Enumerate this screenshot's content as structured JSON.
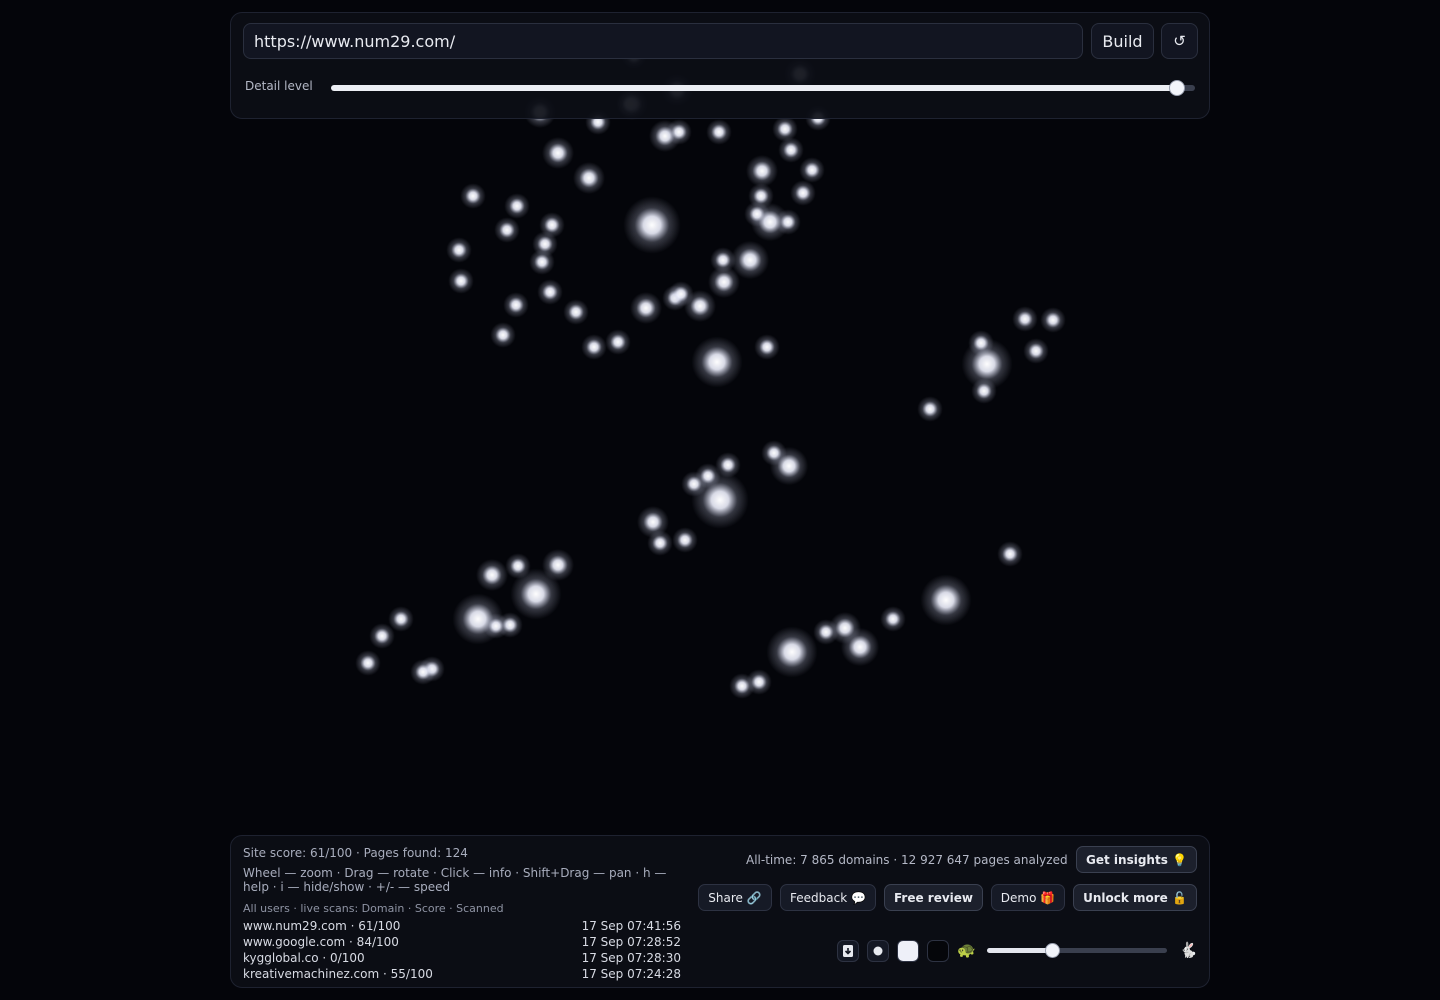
{
  "toolbar": {
    "url_value": "https://www.num29.com/",
    "build_label": "Build",
    "reset_label": "↺",
    "detail_label": "Detail level",
    "detail_value_fraction": 0.98
  },
  "stats": {
    "site_score": "Site score: 61/100 · Pages found: 124",
    "help": "Wheel — zoom · Drag — rotate · Click — info · Shift+Drag — pan · h — help · i — hide/show · +/- — speed",
    "all_time": "All-time: 7 865 domains · 12 927 647 pages analyzed"
  },
  "scans": {
    "header": "All users · live scans: Domain · Score · Scanned",
    "rows": [
      {
        "domain": "www.num29.com · 61/100",
        "time": "17 Sep 07:41:56"
      },
      {
        "domain": "www.google.com · 84/100",
        "time": "17 Sep 07:28:52"
      },
      {
        "domain": "kygglobal.co · 0/100",
        "time": "17 Sep 07:28:30"
      },
      {
        "domain": "kreativemachinez.com · 55/100",
        "time": "17 Sep 07:24:28"
      }
    ]
  },
  "actions": {
    "get_insights": "Get insights 💡",
    "share": "Share 🔗",
    "feedback": "Feedback 💬",
    "free_review": "Free review",
    "demo": "Demo 🎁",
    "unlock_more": "Unlock more 🔓"
  },
  "controls": {
    "speed_value_fraction": 0.37,
    "slow_icon": "🐢",
    "fast_icon": "🐇"
  },
  "colors": {
    "background": "#04050a",
    "node": "#ffffff"
  }
}
